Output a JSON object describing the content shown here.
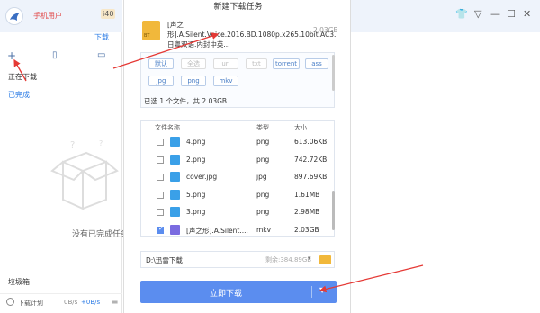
{
  "app": {
    "username": "手机用户",
    "vip_badge": "i40",
    "tab_download": "下载",
    "section_downloading": "正在下载",
    "section_completed": "已完成",
    "empty_text": "没有已完成任务",
    "trash": "垃圾箱",
    "schedule": "下载计划",
    "speed_down": "0B/s",
    "speed_up": "+0B/s",
    "icons": [
      "plus-icon",
      "file-icon",
      "folder-icon",
      "shirt-icon",
      "dropdown-icon",
      "minimize-icon",
      "maximize-icon",
      "close-icon"
    ]
  },
  "dialog": {
    "title": "新建下载任务",
    "file": {
      "icon_label": "BT",
      "name": "[声之形].A.Silent.Voice.2016.BD.1080p.x265.10bit.AC3.日粤双语.内封中英...",
      "size": "2.03GB"
    },
    "filters": [
      {
        "label": "默认",
        "enabled": true
      },
      {
        "label": "全选",
        "enabled": false
      },
      {
        "label": "url",
        "enabled": false
      },
      {
        "label": "txt",
        "enabled": false
      },
      {
        "label": "torrent",
        "enabled": true
      },
      {
        "label": "ass",
        "enabled": true
      },
      {
        "label": "jpg",
        "enabled": true
      },
      {
        "label": "png",
        "enabled": true
      },
      {
        "label": "mkv",
        "enabled": true
      }
    ],
    "summary": "已选 1 个文件，共 2.03GB",
    "columns": {
      "name": "文件名称",
      "type": "类型",
      "size": "大小"
    },
    "rows": [
      {
        "name": "4.png",
        "type": "png",
        "size": "613.06KB",
        "checked": false,
        "kind": "image"
      },
      {
        "name": "2.png",
        "type": "png",
        "size": "742.72KB",
        "checked": false,
        "kind": "image"
      },
      {
        "name": "cover.jpg",
        "type": "jpg",
        "size": "897.69KB",
        "checked": false,
        "kind": "image"
      },
      {
        "name": "5.png",
        "type": "png",
        "size": "1.61MB",
        "checked": false,
        "kind": "image"
      },
      {
        "name": "3.png",
        "type": "png",
        "size": "2.98MB",
        "checked": false,
        "kind": "image"
      },
      {
        "name": "[声之形].A.Silent....",
        "type": "mkv",
        "size": "2.03GB",
        "checked": true,
        "kind": "video"
      }
    ],
    "save_path": "D:\\迅雷下载",
    "free_space": "剩余:384.89GB",
    "download_button": "立即下载",
    "colors": {
      "primary": "#5b8def",
      "annotation": "#e53935"
    }
  }
}
